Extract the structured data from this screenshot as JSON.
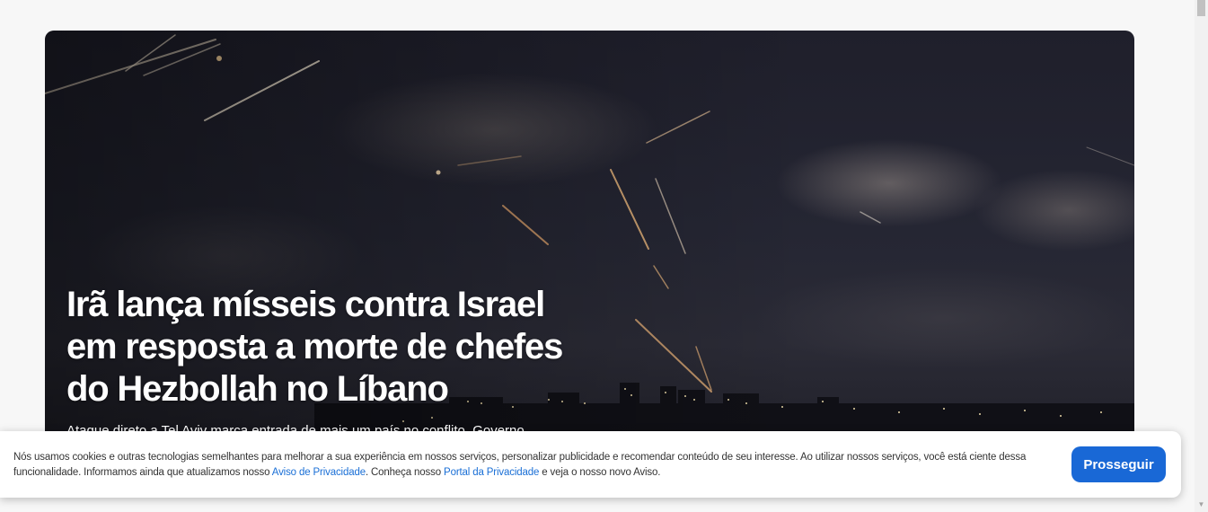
{
  "hero": {
    "image_description_icon": "missile-night-sky-image",
    "title_lines": [
      "Irã lança mísseis contra Israel",
      "em resposta a morte de chefes",
      "do Hezbollah no Líbano"
    ],
    "subtitle": "Ataque direto a Tel Aviv marca entrada de mais um país no conflito. Governo"
  },
  "cookie_banner": {
    "text_part1": "Nós usamos cookies e outras tecnologias semelhantes para melhorar a sua experiência em nossos serviços, personalizar publicidade e recomendar conteúdo de seu interesse. Ao utilizar nossos serviços, você está ciente dessa funcionalidade. Informamos ainda que atualizamos nosso ",
    "privacy_notice_link": "Aviso de Privacidade",
    "text_part2": ". Conheça nosso ",
    "privacy_portal_link": "Portal da Privacidade",
    "text_part3": " e veja o nosso novo Aviso.",
    "button_label": "Prosseguir",
    "button_color": "#1968d6",
    "link_color": "#1a6fd6"
  },
  "scrollbar": {
    "up_icon": "chevron-up-icon",
    "down_icon": "chevron-down-icon"
  }
}
